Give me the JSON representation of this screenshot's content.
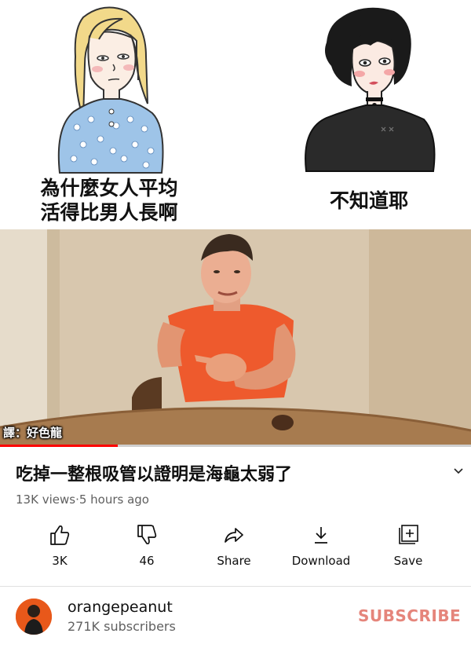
{
  "meme": {
    "left_caption": "為什麼女人平均\n活得比男人長啊",
    "right_caption": "不知道耶"
  },
  "video": {
    "translator_tag": "譯：好色龍",
    "progress_fraction": 0.25,
    "progress_color": "#ff0000"
  },
  "info": {
    "title": "吃掉一整根吸管以證明是海龜太弱了",
    "views": "13K views",
    "separator": " · ",
    "age": "5 hours ago",
    "expand_icon": "chevron-down-icon"
  },
  "actions": [
    {
      "label": "3K",
      "icon": "thumbs-up-icon"
    },
    {
      "label": "46",
      "icon": "thumbs-down-icon"
    },
    {
      "label": "Share",
      "icon": "share-arrow-icon"
    },
    {
      "label": "Download",
      "icon": "download-icon"
    },
    {
      "label": "Save",
      "icon": "save-playlist-icon"
    }
  ],
  "channel": {
    "name": "orangepeanut",
    "subscribers": "271K subscribers",
    "subscribe_label": "SUBSCRIBE",
    "subscribe_color": "#e5857b"
  }
}
